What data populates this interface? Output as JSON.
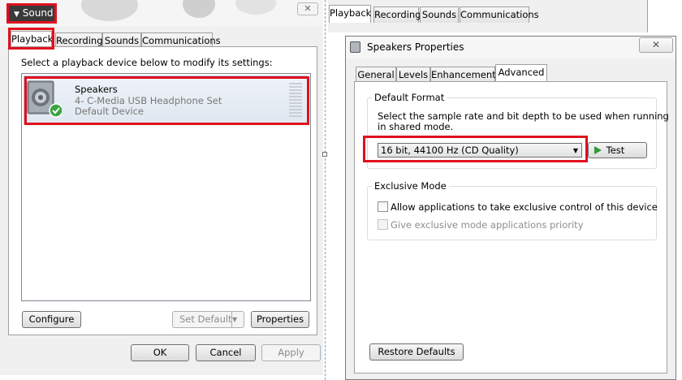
{
  "sound_dialog": {
    "title": "Sound",
    "close_glyph": "✕",
    "tabs": [
      {
        "label": "Playback",
        "active": true
      },
      {
        "label": "Recording"
      },
      {
        "label": "Sounds"
      },
      {
        "label": "Communications"
      }
    ],
    "instruction": "Select a playback device below to modify its settings:",
    "device": {
      "name": "Speakers",
      "description": "4- C-Media USB Headphone Set",
      "status": "Default Device",
      "icon": "speaker-icon",
      "status_icon": "green-check-icon"
    },
    "buttons": {
      "configure": "Configure",
      "set_default": "Set Default",
      "properties": "Properties",
      "ok": "OK",
      "cancel": "Cancel",
      "apply": "Apply"
    }
  },
  "background_window": {
    "tabs": [
      {
        "label": "Playback"
      },
      {
        "label": "Recording"
      },
      {
        "label": "Sounds"
      },
      {
        "label": "Communications"
      }
    ]
  },
  "properties_dialog": {
    "title": "Speakers Properties",
    "close_glyph": "✕",
    "tabs": [
      {
        "label": "General"
      },
      {
        "label": "Levels"
      },
      {
        "label": "Enhancements"
      },
      {
        "label": "Advanced",
        "active": true
      }
    ],
    "default_format": {
      "group_title": "Default Format",
      "description_line1": "Select the sample rate and bit depth to be used when running",
      "description_line2": "in shared mode.",
      "selected_format": "16 bit, 44100 Hz (CD Quality)",
      "test_button": "Test"
    },
    "exclusive_mode": {
      "group_title": "Exclusive Mode",
      "allow_exclusive": {
        "label": "Allow applications to take exclusive control of this device",
        "checked": false
      },
      "give_priority": {
        "label": "Give exclusive mode applications priority",
        "checked": false,
        "disabled": true
      }
    },
    "restore_defaults_button": "Restore Defaults"
  },
  "colors": {
    "highlight": "#e0101e",
    "dialog_bg": "#f0f0f0",
    "test_play_icon": "#2e9a38"
  }
}
